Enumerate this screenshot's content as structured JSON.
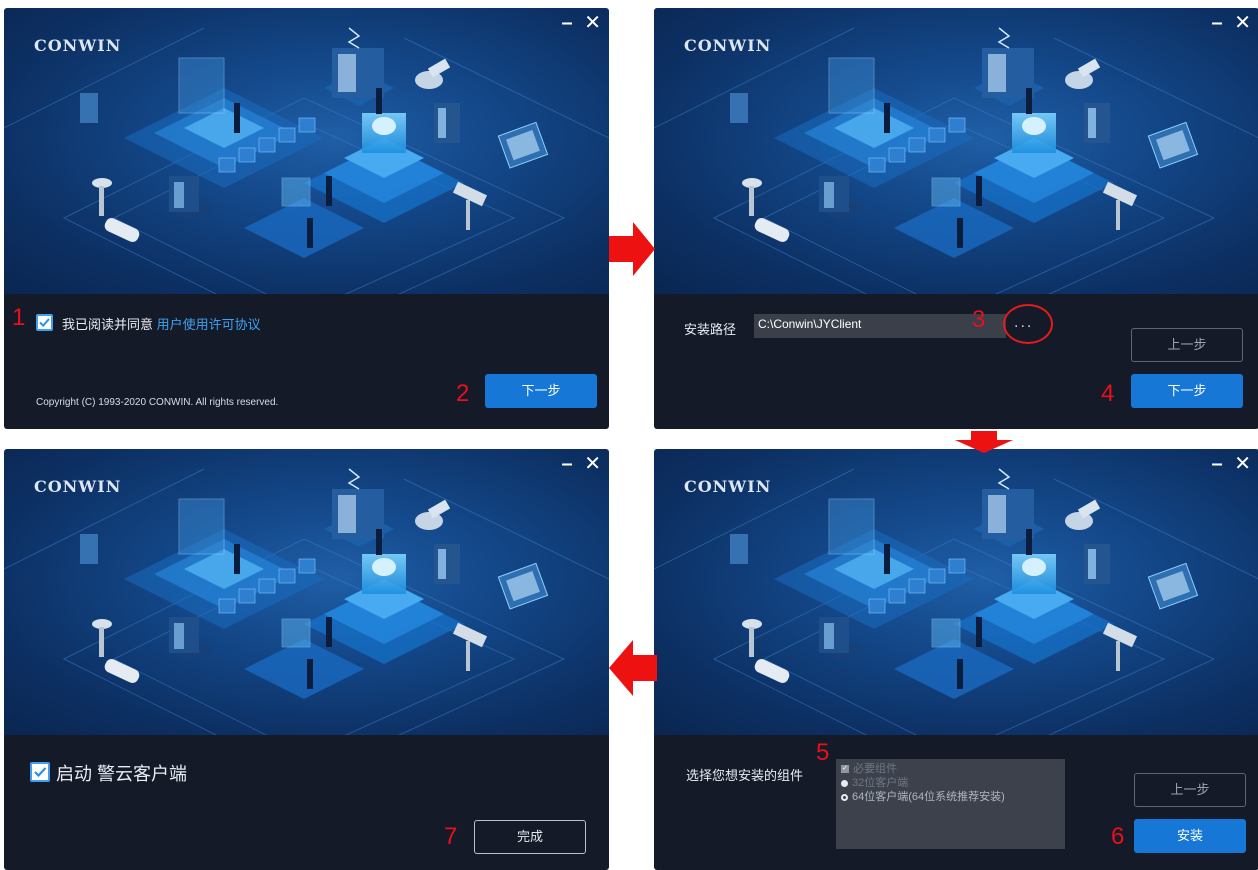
{
  "brand": "CONWIN",
  "window_controls": {
    "minimize": "–",
    "close": "✕"
  },
  "colors": {
    "accent": "#1677d6",
    "link": "#3ea2f2",
    "annotation": "#e8101b",
    "panel": "#141a28"
  },
  "step1": {
    "agree_label": "我已阅读并同意",
    "agree_link": "用户使用许可协议",
    "agree_checked": true,
    "copyright": "Copyright (C) 1993-2020 CONWIN. All rights reserved.",
    "next_label": "下一步",
    "marker_agree": "1",
    "marker_next": "2"
  },
  "step2": {
    "path_label": "安装路径",
    "path_value": "C:\\Conwin\\JYClient",
    "browse_label": "...",
    "back_label": "上一步",
    "next_label": "下一步",
    "marker_browse": "3",
    "marker_next": "4"
  },
  "step3": {
    "components_label": "选择您想安装的组件",
    "options": [
      {
        "label": "必要组件",
        "kind": "check",
        "selected": true
      },
      {
        "label": "32位客户端",
        "kind": "radio",
        "selected": false
      },
      {
        "label": "64位客户端(64位系统推荐安装)",
        "kind": "radio",
        "selected": true
      }
    ],
    "back_label": "上一步",
    "install_label": "安装",
    "marker_components": "5",
    "marker_install": "6"
  },
  "step4": {
    "launch_label": "启动 警云客户端",
    "launch_checked": true,
    "finish_label": "完成",
    "marker_finish": "7"
  }
}
